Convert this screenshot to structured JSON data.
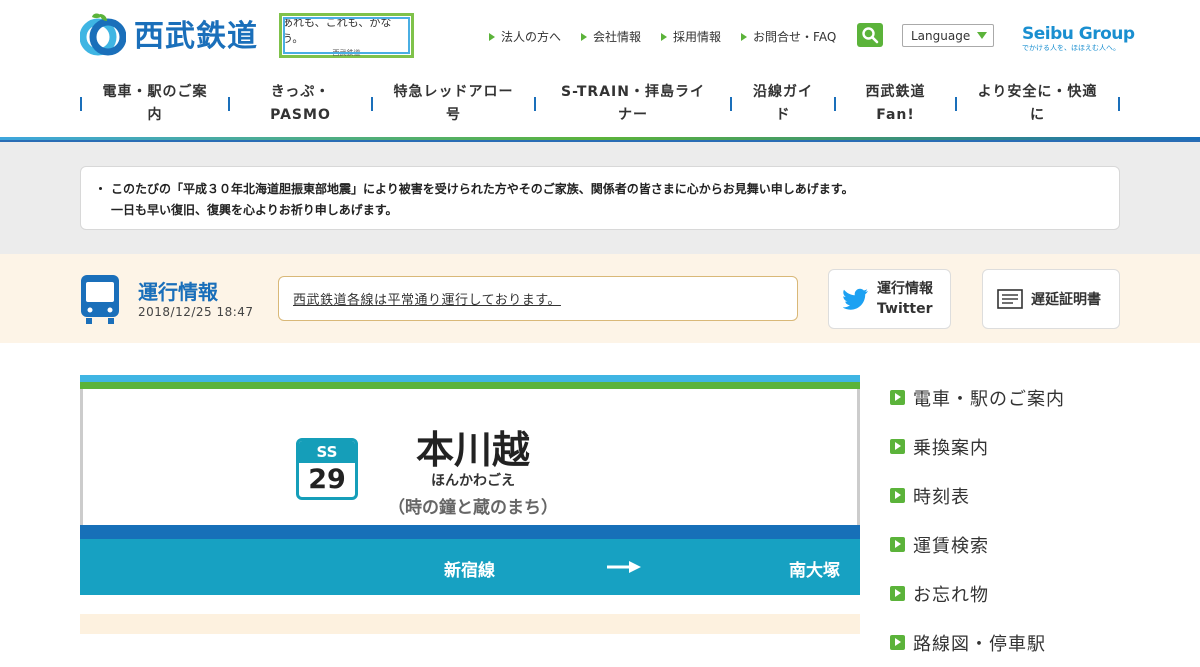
{
  "brand": {
    "logo_text": "西武鉄道",
    "slogan_line1": "あれも、これも、かなう。",
    "slogan_line2": "西武鉄道",
    "group_logo": "Seibu Group",
    "group_tagline": "でかける人を、ほほえむ人へ。",
    "colors": {
      "primary_blue": "#1a6fba",
      "green": "#5bb33a",
      "teal": "#17a1c2",
      "light_blue": "#3fb5e3"
    }
  },
  "utility_nav": [
    {
      "label": "法人の方へ"
    },
    {
      "label": "会社情報"
    },
    {
      "label": "採用情報"
    },
    {
      "label": "お問合せ・FAQ"
    }
  ],
  "search": {
    "icon": "search-icon"
  },
  "language": {
    "label": "Language"
  },
  "global_nav": [
    {
      "line1": "電車・駅のご案",
      "line2": "内"
    },
    {
      "line1": "きっぷ・",
      "line2": "PASMO"
    },
    {
      "line1": "特急レッドアロー",
      "line2": "号"
    },
    {
      "line1": "S-TRAIN・拝島ライ",
      "line2": "ナー"
    },
    {
      "line1": "沿線ガイ",
      "line2": "ド"
    },
    {
      "line1": "西武鉄道",
      "line2": "Fan!"
    },
    {
      "line1": "より安全に・快適",
      "line2": "に"
    }
  ],
  "notice": {
    "line1": "このたびの「平成３０年北海道胆振東部地震」により被害を受けられた方やそのご家族、関係者の皆さまに心からお見舞い申しあげます。",
    "line2": "一日も早い復旧、復興を心よりお祈り申しあげます。"
  },
  "operation": {
    "title": "運行情報",
    "timestamp": "2018/12/25 18:47",
    "message": "西武鉄道各線は平常通り運行しております。",
    "twitter_line1": "運行情報",
    "twitter_line2": "Twitter",
    "delay_cert": "遅延証明書"
  },
  "station": {
    "line_code": "SS",
    "number": "29",
    "name": "本川越",
    "kana": "ほんかわごえ",
    "subtitle": "（時の鐘と蔵のまち）",
    "line_name": "新宿線",
    "next_station": "南大塚"
  },
  "sidebar": [
    {
      "label": "電車・駅のご案内"
    },
    {
      "label": "乗換案内"
    },
    {
      "label": "時刻表"
    },
    {
      "label": "運賃検索"
    },
    {
      "label": "お忘れ物"
    },
    {
      "label": "路線図・停車駅"
    }
  ]
}
